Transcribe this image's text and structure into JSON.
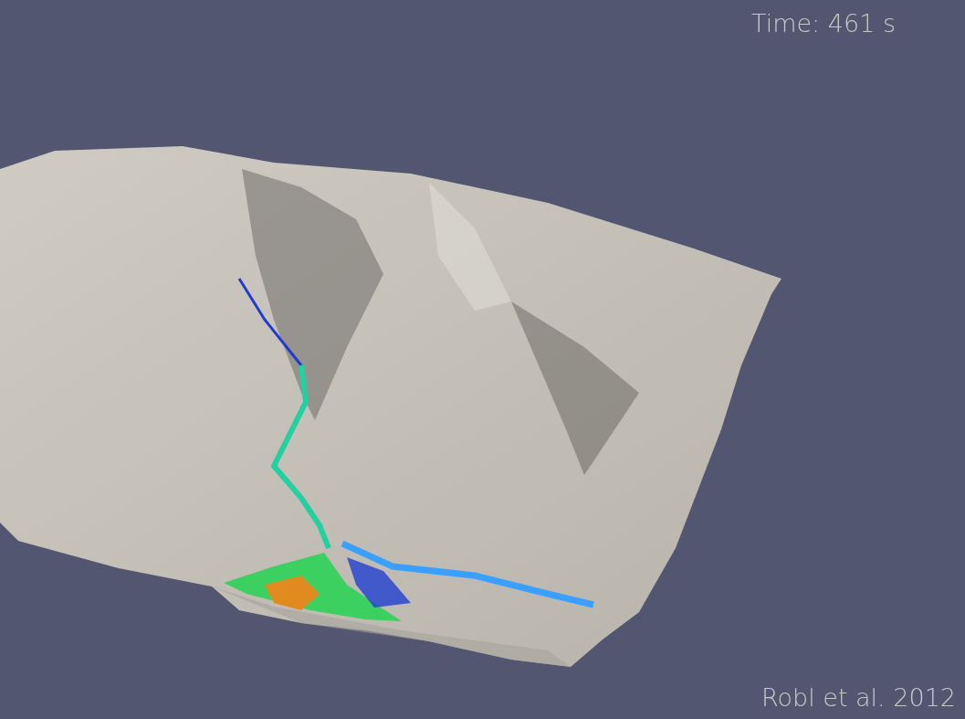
{
  "viewport": {
    "time_label": "Time: 461 s",
    "credit": "Robl et al. 2012"
  }
}
